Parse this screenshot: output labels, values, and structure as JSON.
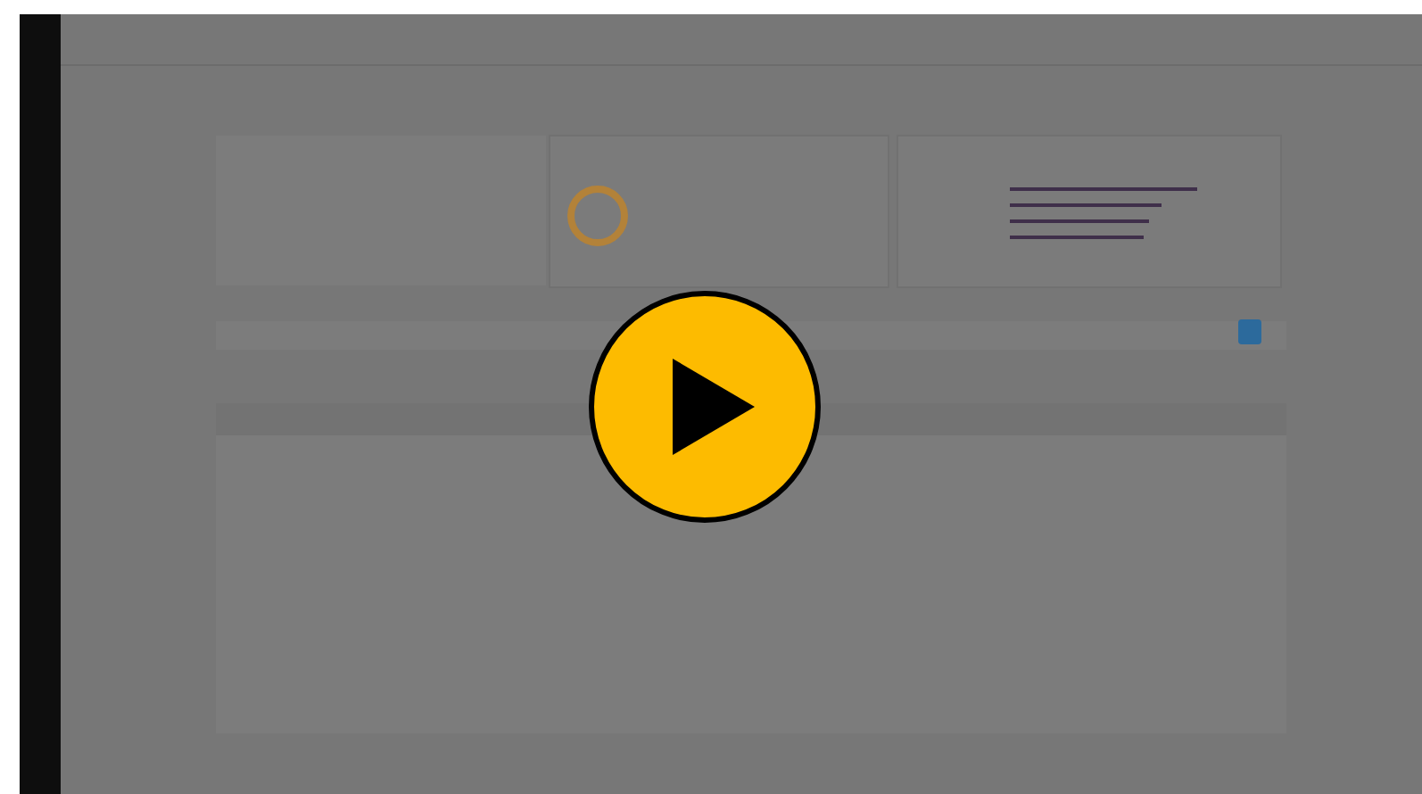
{
  "player": {
    "playing": false
  }
}
